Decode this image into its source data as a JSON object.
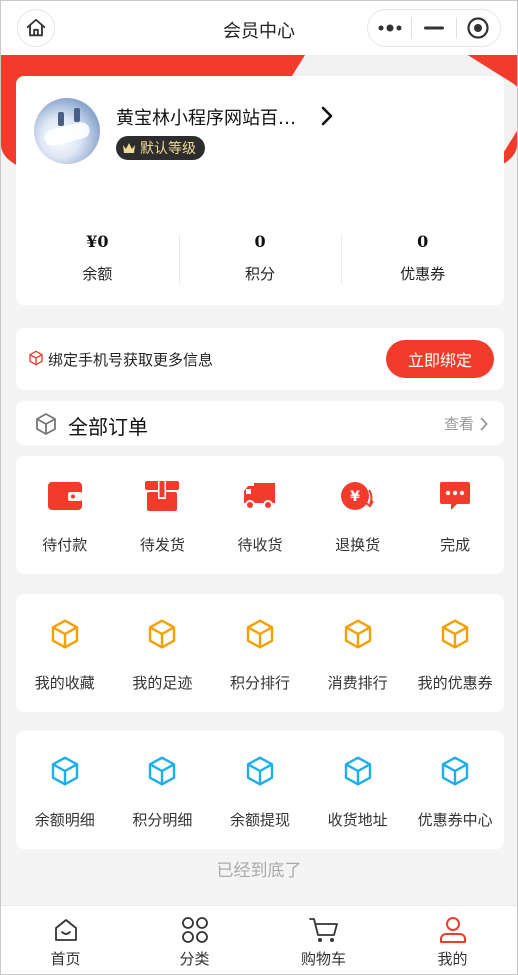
{
  "header": {
    "title": "会员中心",
    "home_icon": "home-icon",
    "more_icon": "more-dots-icon",
    "minimize_icon": "minimize-icon",
    "close_icon": "target-close-icon"
  },
  "colors": {
    "accent": "#f33b2b",
    "orange": "#f5a000",
    "blue": "#1ab0ee"
  },
  "profile": {
    "name": "黄宝林小程序网站百…",
    "level": "默认等级",
    "stats": [
      {
        "value": "¥0",
        "label": "余额"
      },
      {
        "value": "0",
        "label": "积分"
      },
      {
        "value": "0",
        "label": "优惠券"
      }
    ]
  },
  "bind_phone": {
    "text": "绑定手机号获取更多信息",
    "button": "立即绑定"
  },
  "orders": {
    "title": "全部订单",
    "more": "查看",
    "items": [
      {
        "label": "待付款",
        "icon": "wallet-icon"
      },
      {
        "label": "待发货",
        "icon": "box-icon"
      },
      {
        "label": "待收货",
        "icon": "truck-icon"
      },
      {
        "label": "退换货",
        "icon": "refund-icon"
      },
      {
        "label": "完成",
        "icon": "chat-icon"
      }
    ]
  },
  "services_row1": [
    {
      "label": "我的收藏"
    },
    {
      "label": "我的足迹"
    },
    {
      "label": "积分排行"
    },
    {
      "label": "消费排行"
    },
    {
      "label": "我的优惠券"
    }
  ],
  "services_row2": [
    {
      "label": "余额明细"
    },
    {
      "label": "积分明细"
    },
    {
      "label": "余额提现"
    },
    {
      "label": "收货地址"
    },
    {
      "label": "优惠券中心"
    }
  ],
  "footer_note": "已经到底了",
  "bottom_nav": [
    {
      "label": "首页"
    },
    {
      "label": "分类"
    },
    {
      "label": "购物车"
    },
    {
      "label": "我的"
    }
  ]
}
